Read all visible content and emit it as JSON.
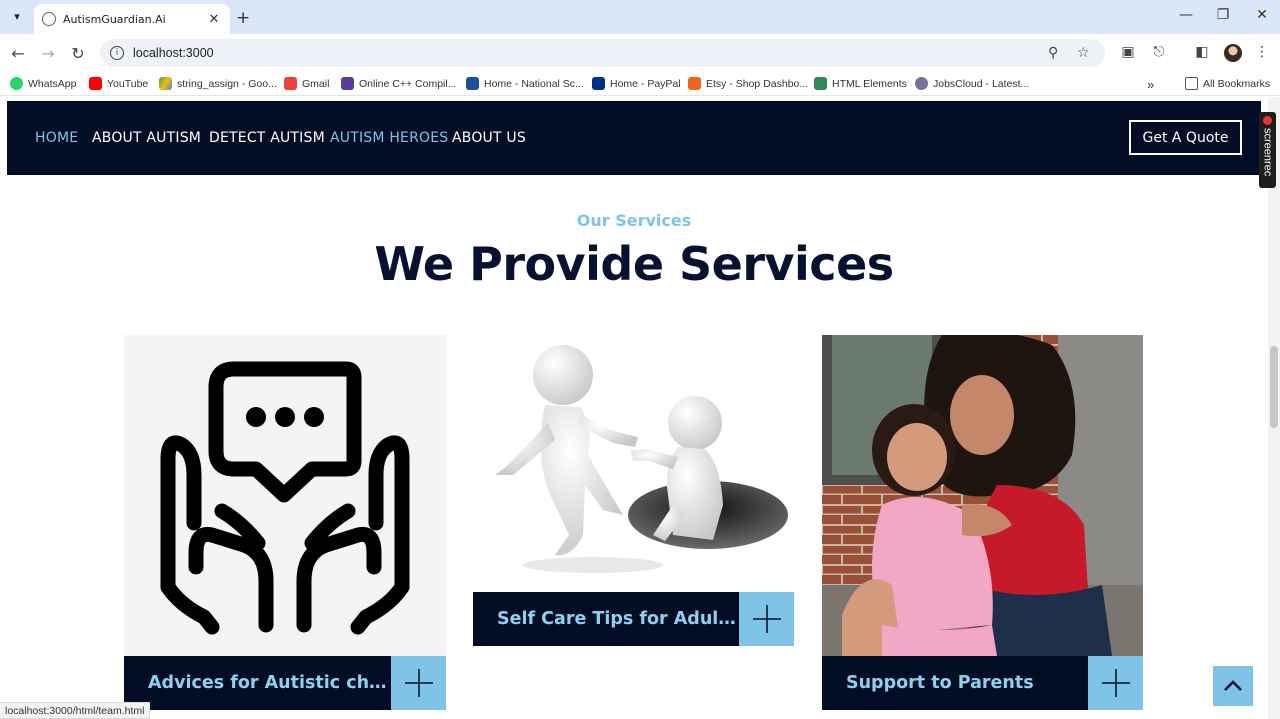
{
  "browser": {
    "tab_title": "AutismGuardian.Ai",
    "url": "localhost:3000",
    "status_url": "localhost:3000/html/team.html",
    "bookmarks": [
      {
        "label": "WhatsApp",
        "color": "#25d366"
      },
      {
        "label": "YouTube",
        "color": "#ff0000"
      },
      {
        "label": "string_assign - Goo...",
        "color": "#fbbc04"
      },
      {
        "label": "Gmail",
        "color": "#ea4335"
      },
      {
        "label": "Online C++ Compil...",
        "color": "#5b3a9e"
      },
      {
        "label": "Home - National Sc...",
        "color": "#1e4f9a"
      },
      {
        "label": "Home - PayPal",
        "color": "#003087"
      },
      {
        "label": "Etsy - Shop Dashbo...",
        "color": "#f1641e"
      },
      {
        "label": "HTML Elements",
        "color": "#2e8b57"
      },
      {
        "label": "JobsCloud - Latest...",
        "color": "#7a6f9b"
      }
    ],
    "all_bookmarks": "All Bookmarks",
    "screenrec_label": "screenrec"
  },
  "site": {
    "nav": [
      {
        "label": "HOME",
        "active": true
      },
      {
        "label": "ABOUT AUTISM",
        "active": false
      },
      {
        "label": "DETECT AUTISM",
        "active": false
      },
      {
        "label": "AUTISM HEROES",
        "active": true
      },
      {
        "label": "ABOUT US",
        "active": false
      }
    ],
    "quote_button": "Get A Quote",
    "eyebrow": "Our Services",
    "headline": "We Provide Services",
    "services": [
      {
        "title": "Advices for Autistic chi..."
      },
      {
        "title": "Self Care Tips for Adult..."
      },
      {
        "title": "Support to Parents"
      }
    ],
    "colors": {
      "nav_bg": "#030e26",
      "accent": "#7fc4e8",
      "headline": "#071230"
    }
  }
}
